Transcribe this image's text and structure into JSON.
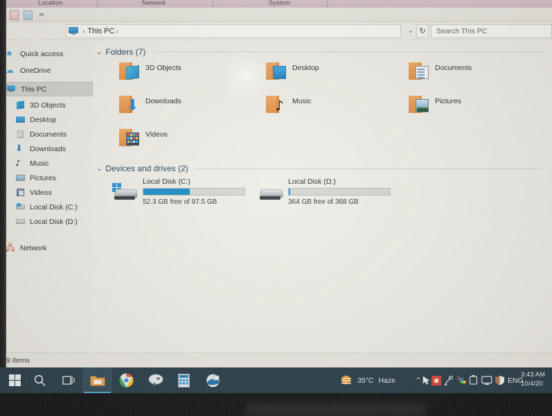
{
  "window": {
    "title": "This PC",
    "ribbon_groups": [
      "Location",
      "Network",
      "System"
    ],
    "quick_access_icons": [
      "properties-icon",
      "open-icon",
      "customize-quick-access-icon"
    ]
  },
  "addressbar": {
    "back_icon": "back-arrow-icon",
    "forward_icon": "forward-arrow-icon",
    "recent_icon": "chevron-down-icon",
    "up_icon": "up-arrow-icon",
    "breadcrumb_icon": "this-pc-icon",
    "breadcrumb_text": "This PC",
    "separator": "›",
    "dropdown_icon": "chevron-down-icon",
    "refresh_icon": "↻"
  },
  "search": {
    "placeholder": "Search This PC"
  },
  "sidebar": {
    "items": [
      {
        "label": "Quick access",
        "icon": "star-icon",
        "indent": false,
        "selected": false
      },
      {
        "label": "OneDrive",
        "icon": "cloud-icon",
        "indent": false,
        "selected": false
      },
      {
        "label": "This PC",
        "icon": "this-pc-icon",
        "indent": false,
        "selected": true
      },
      {
        "label": "3D Objects",
        "icon": "3d-objects-icon",
        "indent": true,
        "selected": false
      },
      {
        "label": "Desktop",
        "icon": "desktop-icon",
        "indent": true,
        "selected": false
      },
      {
        "label": "Documents",
        "icon": "documents-icon",
        "indent": true,
        "selected": false
      },
      {
        "label": "Downloads",
        "icon": "downloads-icon",
        "indent": true,
        "selected": false
      },
      {
        "label": "Music",
        "icon": "music-icon",
        "indent": true,
        "selected": false
      },
      {
        "label": "Pictures",
        "icon": "pictures-icon",
        "indent": true,
        "selected": false
      },
      {
        "label": "Videos",
        "icon": "videos-icon",
        "indent": true,
        "selected": false
      },
      {
        "label": "Local Disk (C:)",
        "icon": "drive-c-icon",
        "indent": true,
        "selected": false
      },
      {
        "label": "Local Disk (D:)",
        "icon": "drive-d-icon",
        "indent": true,
        "selected": false
      },
      {
        "label": "Network",
        "icon": "network-icon",
        "indent": false,
        "selected": false
      }
    ]
  },
  "content": {
    "folders_group": {
      "label": "Folders (7)",
      "chevron": "⌄",
      "items": [
        {
          "name": "3D Objects",
          "icon": "folder-3d-objects-icon"
        },
        {
          "name": "Desktop",
          "icon": "folder-desktop-icon"
        },
        {
          "name": "Documents",
          "icon": "folder-documents-icon"
        },
        {
          "name": "Downloads",
          "icon": "folder-downloads-icon"
        },
        {
          "name": "Music",
          "icon": "folder-music-icon"
        },
        {
          "name": "Pictures",
          "icon": "folder-pictures-icon"
        },
        {
          "name": "Videos",
          "icon": "folder-videos-icon"
        }
      ]
    },
    "devices_group": {
      "label": "Devices and drives (2)",
      "chevron": "⌄",
      "drives": [
        {
          "name": "Local Disk (C:)",
          "free_text": "52.3 GB free of 97.5 GB",
          "used_percent": 46,
          "icon": "drive-windows-icon",
          "bar_color": "#1289c7"
        },
        {
          "name": "Local Disk (D:)",
          "free_text": "364 GB free of 368 GB",
          "used_percent": 1,
          "icon": "drive-icon",
          "bar_color": "#1289c7"
        }
      ]
    }
  },
  "statusbar": {
    "item_count": "9 items"
  },
  "taskbar": {
    "buttons": [
      {
        "name": "start-button",
        "icon": "windows-logo-icon",
        "active": false
      },
      {
        "name": "search-button",
        "icon": "search-icon",
        "active": false
      },
      {
        "name": "task-view-button",
        "icon": "task-view-icon",
        "active": false
      },
      {
        "name": "file-explorer-button",
        "icon": "folder-icon",
        "active": true
      },
      {
        "name": "chrome-button",
        "icon": "chrome-icon",
        "active": false
      },
      {
        "name": "paint-button",
        "icon": "paint-icon",
        "active": false
      },
      {
        "name": "calculator-button",
        "icon": "calculator-icon",
        "active": false
      },
      {
        "name": "store-button",
        "icon": "app-icon",
        "active": false
      }
    ],
    "weather": {
      "icon": "haze-icon",
      "temperature": "35°C",
      "condition": "Haze"
    },
    "tray": {
      "expand_icon": "chevron-up-icon",
      "icons": [
        "cursor-icon",
        "alert-icon",
        "antenna-icon",
        "five-badge-icon",
        "device-icon",
        "display-icon",
        "security-icon"
      ],
      "language": "ENG"
    },
    "clock": {
      "time": "3:43 AM",
      "date": "10/4/20"
    }
  }
}
